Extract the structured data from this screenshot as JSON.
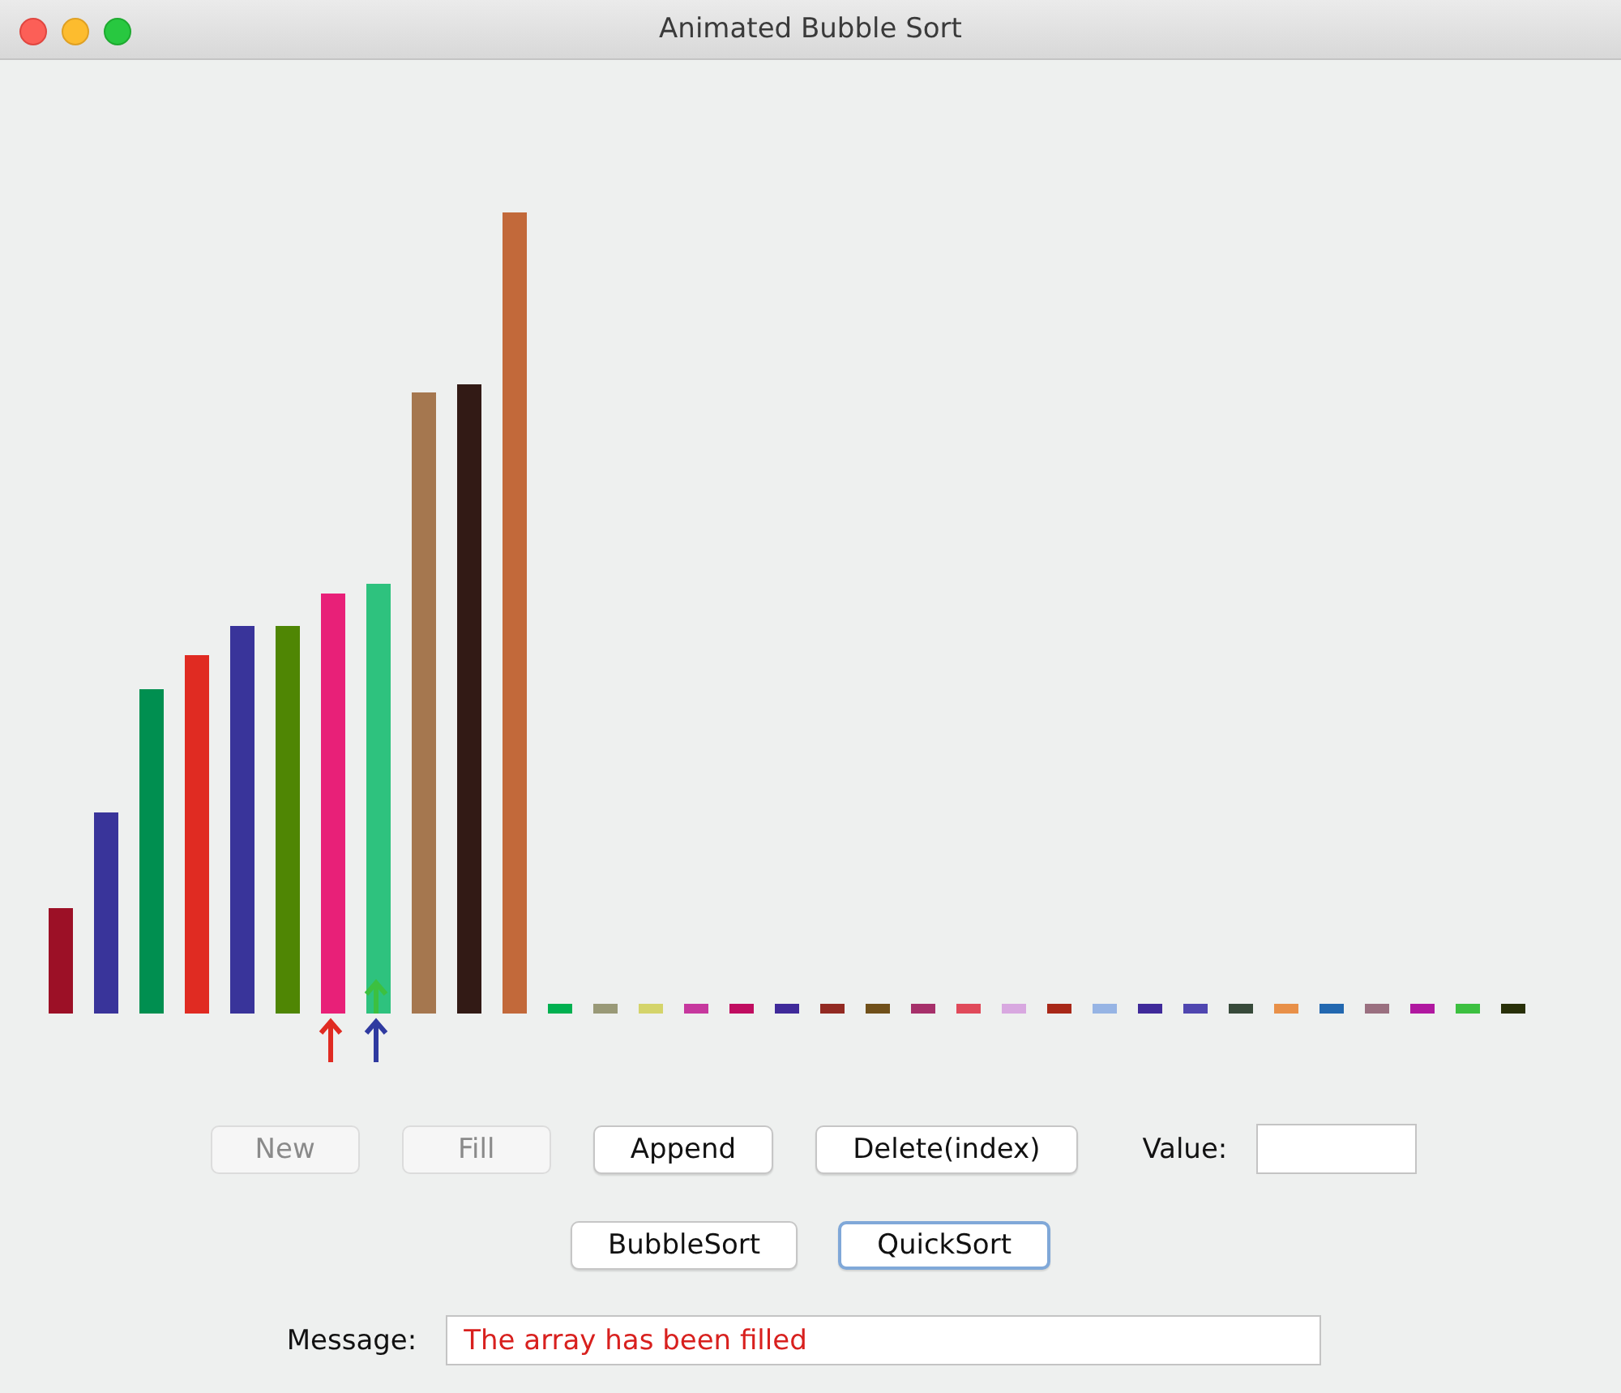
{
  "window": {
    "title": "Animated Bubble Sort"
  },
  "edit_buttons": [
    {
      "label": "New",
      "disabled": true,
      "focused": false
    },
    {
      "label": "Fill",
      "disabled": true,
      "focused": false
    },
    {
      "label": "Append",
      "disabled": false,
      "focused": false
    },
    {
      "label": "Delete(index)",
      "disabled": false,
      "focused": false
    }
  ],
  "value_field": {
    "label": "Value:"
  },
  "sort_buttons": [
    {
      "label": "BubbleSort",
      "disabled": false,
      "focused": false
    },
    {
      "label": "QuickSort",
      "disabled": false,
      "focused": true
    }
  ],
  "message": {
    "label": "Message:",
    "value": "The array has been filled"
  }
}
